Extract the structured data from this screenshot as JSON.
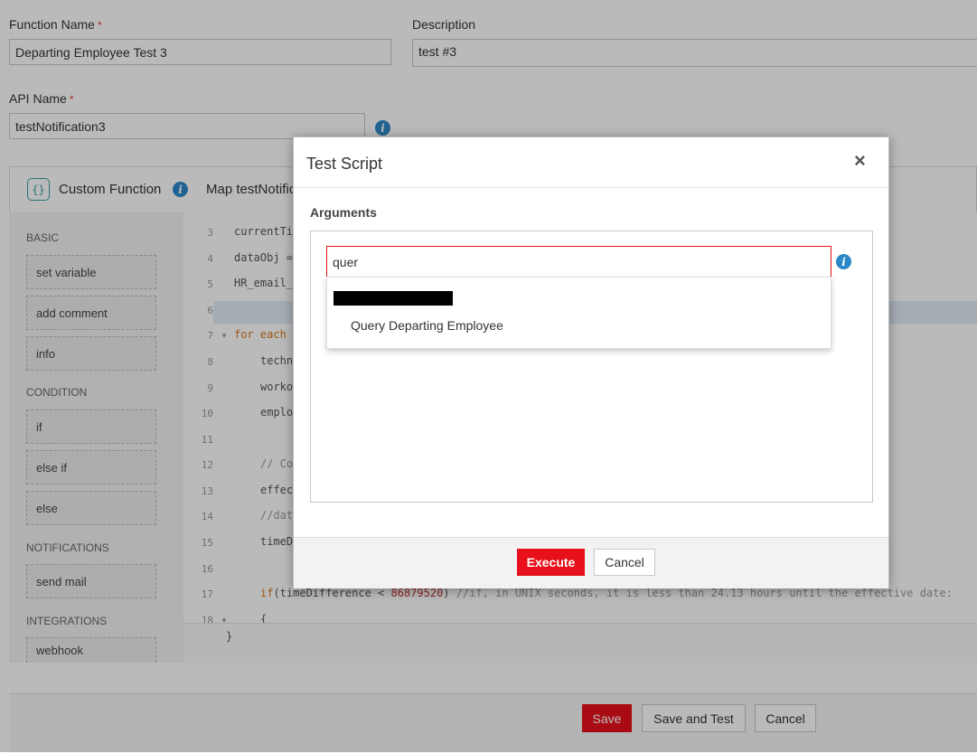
{
  "form": {
    "function_name_label": "Function Name",
    "function_name_value": "Departing Employee Test 3",
    "description_label": "Description",
    "description_value": "test #3",
    "api_name_label": "API Name",
    "api_name_value": "testNotification3",
    "required_mark": "*"
  },
  "editor": {
    "title": "Custom Function",
    "map_label": "Map testNotific",
    "sidebar": {
      "sections": [
        {
          "heading": "BASIC",
          "items": [
            "set variable",
            "add comment",
            "info"
          ]
        },
        {
          "heading": "CONDITION",
          "items": [
            "if",
            "else if",
            "else"
          ]
        },
        {
          "heading": "NOTIFICATIONS",
          "items": [
            "send mail"
          ]
        },
        {
          "heading": "INTEGRATIONS",
          "items": [
            "webhook"
          ]
        }
      ]
    },
    "line_numbers": [
      "3",
      "4",
      "5",
      "6",
      "7",
      "8",
      "9",
      "10",
      "11",
      "12",
      "13",
      "14",
      "15",
      "16",
      "17",
      "18"
    ],
    "code": {
      "l3": "currentTi",
      "l4": "dataObj =",
      "l5": "HR_email_",
      "l7_kw": "for each",
      "l8": "techn",
      "l9": "worko",
      "l10": "emplo",
      "l12": "// Co",
      "l13": "effec",
      "l14": "//dat",
      "l15": "timeD",
      "l17_kw": "if",
      "l17_a": "(timeDifference < ",
      "l17_num": "86879520",
      "l17_b": ") ",
      "l17_cmt": "//if, in UNIX seconds, it is less than 24.13 hours until the effective date:",
      "l18": "{",
      "close_brace": "}"
    }
  },
  "footer": {
    "save": "Save",
    "save_and_test": "Save and Test",
    "cancel": "Cancel"
  },
  "modal": {
    "title": "Test Script",
    "close_glyph": "×",
    "arguments_label": "Arguments",
    "input_value": "quer",
    "suggestions": [
      "Query Departing Employee"
    ],
    "execute": "Execute",
    "cancel": "Cancel"
  },
  "colors": {
    "accent_red": "#e8101a",
    "info_blue": "#2d88c9"
  }
}
